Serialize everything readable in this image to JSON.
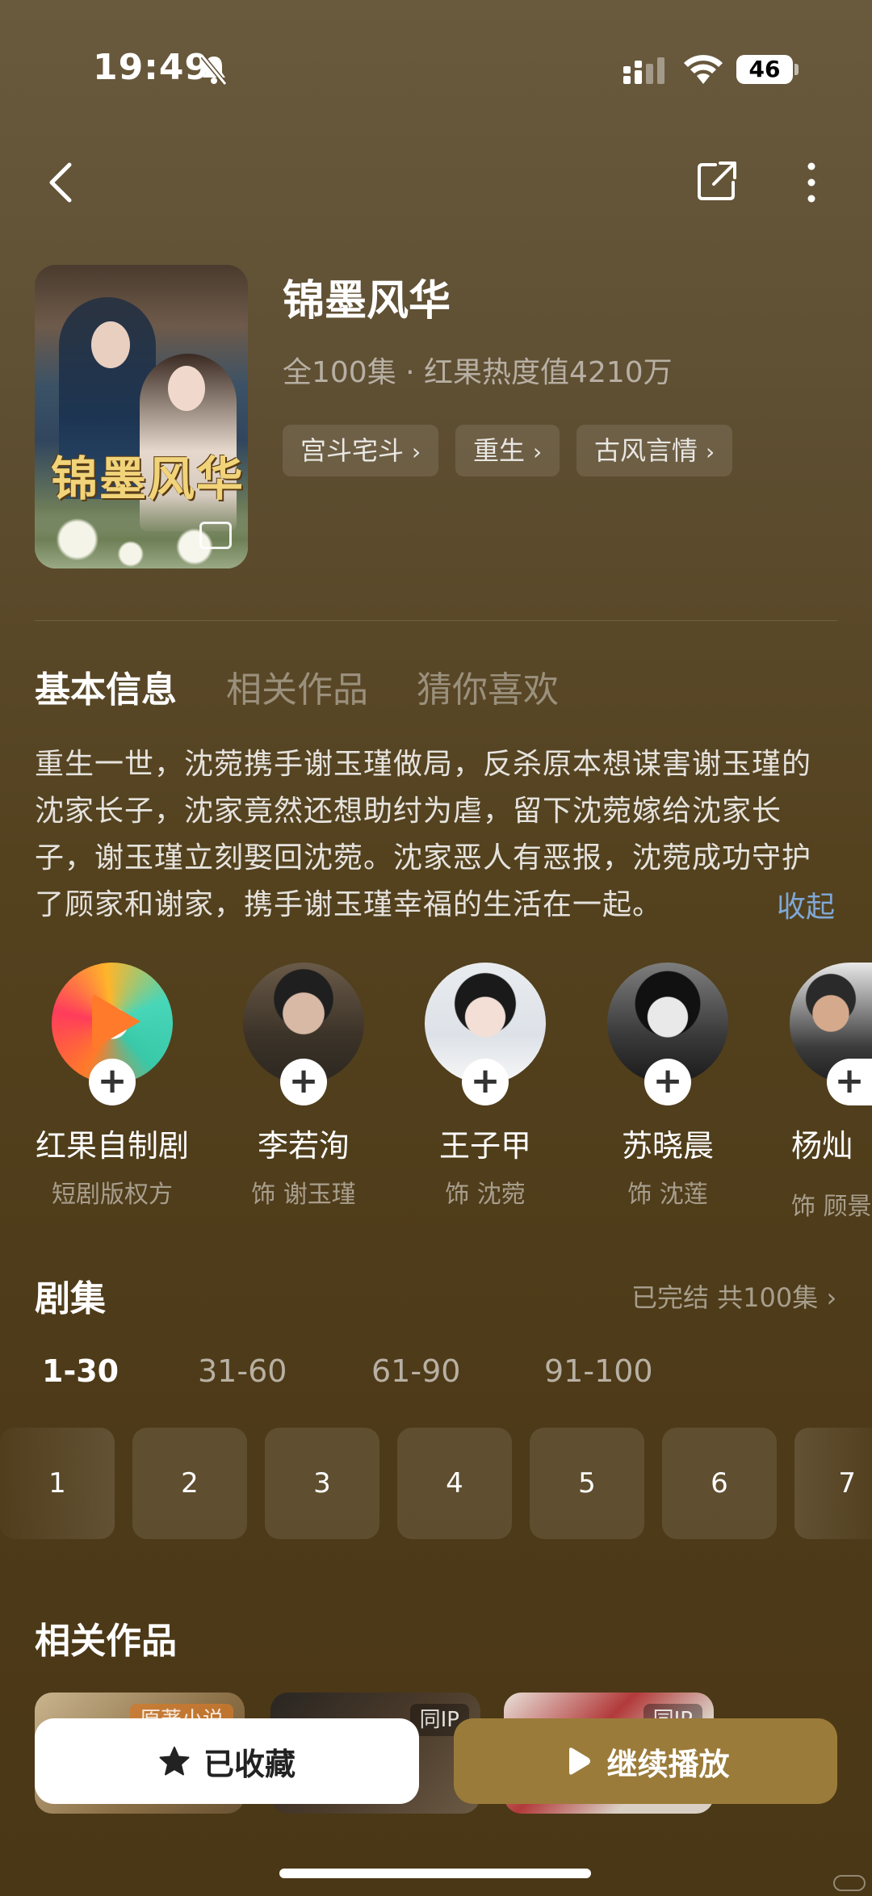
{
  "status_bar": {
    "time": "19:49",
    "battery": "46"
  },
  "drama": {
    "title": "锦墨风华",
    "poster_title": "锦墨风华",
    "meta": "全100集 · 红果热度值4210万",
    "tags": [
      "宫斗宅斗",
      "重生",
      "古风言情"
    ]
  },
  "tabs": [
    "基本信息",
    "相关作品",
    "猜你喜欢"
  ],
  "synopsis": "重生一世，沈菀携手谢玉瑾做局，反杀原本想谋害谢玉瑾的沈家长子，沈家竟然还想助纣为虐，留下沈菀嫁给沈家长子，谢玉瑾立刻娶回沈菀。沈家恶人有恶报，沈菀成功守护了顾家和谢家，携手谢玉瑾幸福的生活在一起。",
  "collapse_label": "收起",
  "cast": [
    {
      "name": "红果自制剧",
      "role": "短剧版权方"
    },
    {
      "name": "李若洵",
      "role": "饰 谢玉瑾"
    },
    {
      "name": "王子甲",
      "role": "饰 沈菀"
    },
    {
      "name": "苏晓晨",
      "role": "饰 沈莲"
    },
    {
      "name": "杨灿",
      "role": "饰 顾景"
    }
  ],
  "episodes": {
    "title": "剧集",
    "status": "已完结 共100集",
    "ranges": [
      "1-30",
      "31-60",
      "61-90",
      "91-100"
    ],
    "numbers": [
      "1",
      "2",
      "3",
      "4",
      "5",
      "6",
      "7"
    ]
  },
  "related": {
    "title": "相关作品",
    "badges": [
      "原著小说",
      "同IP",
      "同IP"
    ]
  },
  "actions": {
    "favorite": "已收藏",
    "play": "继续播放"
  },
  "colors": {
    "accent": "#9b7b3a",
    "link": "#7fa8d6"
  }
}
